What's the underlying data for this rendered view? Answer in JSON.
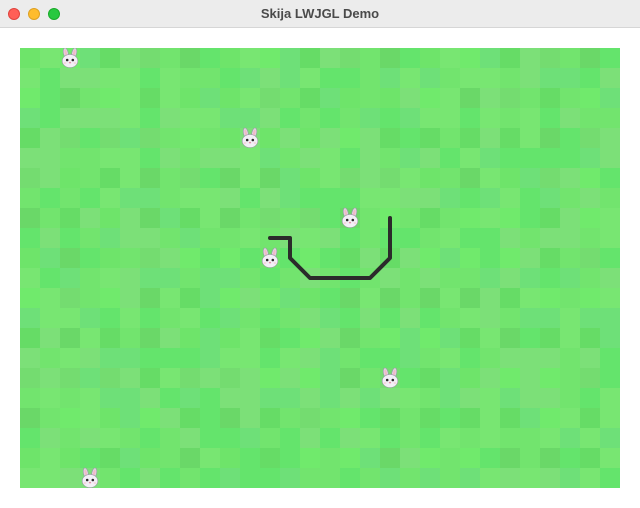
{
  "window": {
    "title": "Skija LWJGL Demo"
  },
  "game": {
    "grid": {
      "columns": 30,
      "rows": 22
    },
    "palette": [
      "#6ee46a",
      "#72e46e",
      "#66dc66",
      "#78e672",
      "#6ad868",
      "#7ce078",
      "#70ea6c",
      "#64e46c",
      "#74dc70",
      "#6ee078"
    ],
    "snake_color": "#2b2b2b",
    "snake": [
      [
        18,
        8
      ],
      [
        18,
        9
      ],
      [
        18,
        10
      ],
      [
        17,
        11
      ],
      [
        16,
        11
      ],
      [
        15,
        11
      ],
      [
        14,
        11
      ],
      [
        13,
        10
      ],
      [
        13,
        9
      ],
      [
        12,
        9
      ]
    ],
    "snake_head": [
      18,
      8
    ],
    "rabbit_icon": "rabbit-face-icon",
    "rabbits": [
      [
        2,
        0
      ],
      [
        11,
        4
      ],
      [
        16,
        8
      ],
      [
        12,
        10
      ],
      [
        18,
        16
      ],
      [
        3,
        21
      ]
    ]
  }
}
